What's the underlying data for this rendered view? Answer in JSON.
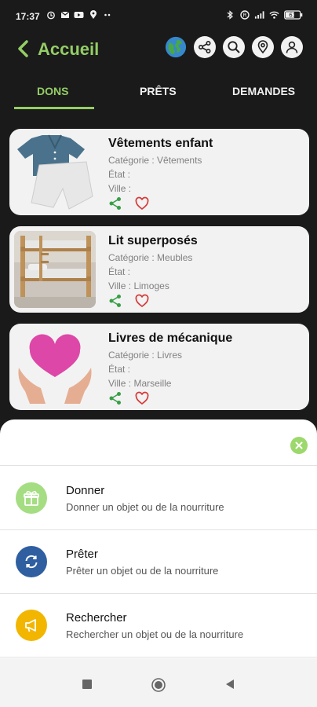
{
  "status_bar": {
    "time": "17:37",
    "battery": "61"
  },
  "header": {
    "title": "Accueil",
    "icons": [
      "globe-icon",
      "share-icon",
      "search-icon",
      "location-icon",
      "user-icon"
    ]
  },
  "tabs": [
    {
      "label": "DONS",
      "active": true
    },
    {
      "label": "PRÊTS",
      "active": false
    },
    {
      "label": "DEMANDES",
      "active": false
    }
  ],
  "items": [
    {
      "title": "Vêtements enfant",
      "category": "Catégorie : Vêtements",
      "state": "État :",
      "city": "Ville :"
    },
    {
      "title": "Lit superposés",
      "category": "Catégorie : Meubles",
      "state": "État :",
      "city": "Ville : Limoges"
    },
    {
      "title": "Livres de mécanique",
      "category": "Catégorie : Livres",
      "state": "État :",
      "city": "Ville : Marseille"
    }
  ],
  "sheet": {
    "options": [
      {
        "title": "Donner",
        "subtitle": "Donner un objet ou de la nourriture",
        "icon": "gift-icon",
        "color": "#a5dd83"
      },
      {
        "title": "Prêter",
        "subtitle": "Prêter un objet ou de la nourriture",
        "icon": "refresh-icon",
        "color": "#2f5fa0"
      },
      {
        "title": "Rechercher",
        "subtitle": "Rechercher un objet ou de la nourriture",
        "icon": "megaphone-icon",
        "color": "#f2b600"
      }
    ]
  },
  "colors": {
    "accent": "#9cd86c",
    "background": "#1c1c1c",
    "share": "#3aa84a",
    "heart": "#e33b3b"
  }
}
